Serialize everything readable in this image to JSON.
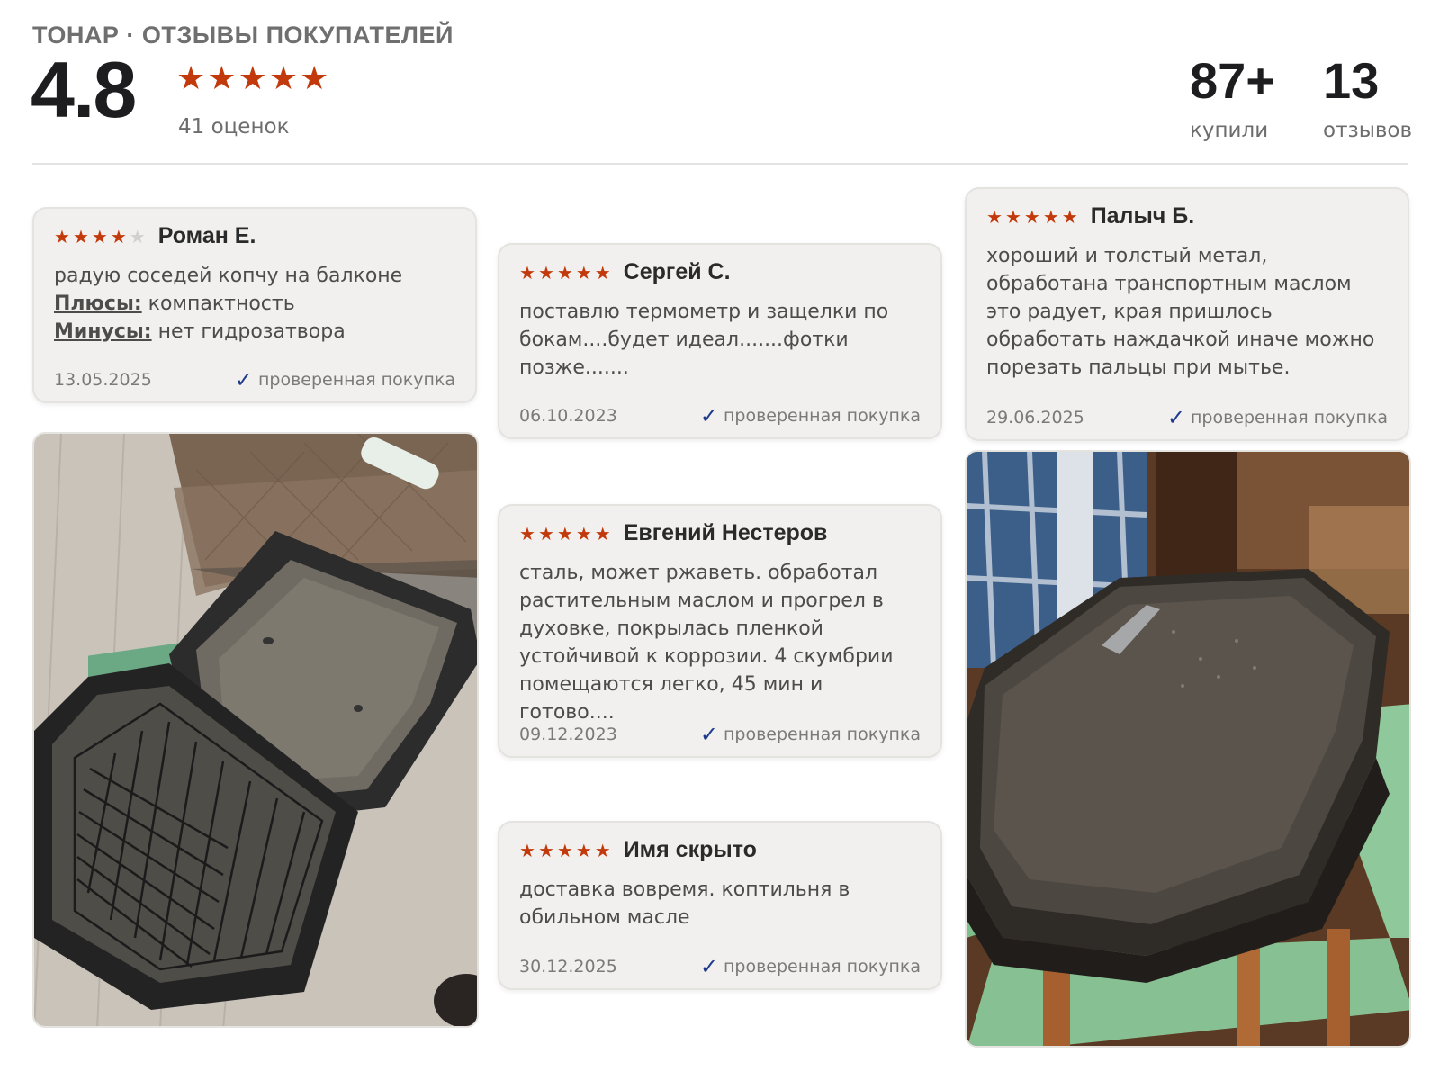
{
  "header": {
    "brand": "ТОНАР · ОТЗЫВЫ ПОКУПАТЕЛЕЙ",
    "rating": "4.8",
    "ratings_count": "41 оценок",
    "stars_count": 5
  },
  "stats": {
    "buyers_value": "87+",
    "buyers_label": "купили",
    "reviews_value": "13",
    "reviews_label": "отзывов"
  },
  "verified_label": "проверенная покупка",
  "reviews": [
    {
      "name": "Роман Е.",
      "stars": 4,
      "text": "радую соседей копчу на балконе",
      "pros_label": "Плюсы:",
      "pros": " компактность",
      "cons_label": "Минусы:",
      "cons": " нет гидрозатвора",
      "date": "13.05.2025"
    },
    {
      "name": "Сергей С.",
      "stars": 5,
      "text": "поставлю термометр и защелки по бокам....будет идеал.......фотки позже.......",
      "date": "06.10.2023"
    },
    {
      "name": "Палыч Б.",
      "stars": 5,
      "text": "хороший и толстый метал, обработана транспортным маслом это радует, края пришлось обработать наждачкой иначе можно порезать пальцы при мытье.",
      "date": "29.06.2025"
    },
    {
      "name": "Евгений Нестеров",
      "stars": 5,
      "text": "сталь, может ржаветь. обработал растительным маслом и прогрел в духовке, покрылась пленкой устойчивой к коррозии. 4 скумбрии помещаются легко, 45 мин и готово....",
      "date": "09.12.2023"
    },
    {
      "name": "Имя скрыто",
      "stars": 5,
      "text": "доставка вовремя. коптильня в обильном масле",
      "date": "30.12.2025"
    }
  ],
  "colors": {
    "star": "#c23a0c",
    "check": "#1e3a8a",
    "card_bg": "#f1f0ee"
  }
}
